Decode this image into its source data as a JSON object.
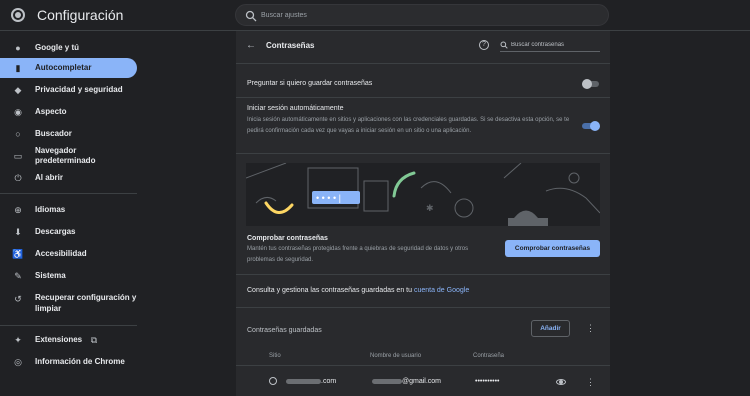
{
  "app": {
    "title": "Configuración",
    "logo_icon": "chrome-logo-icon"
  },
  "search": {
    "placeholder": "Buscar ajustes"
  },
  "sidebar": {
    "items": [
      {
        "label": "Google y tú",
        "icon": "person-icon"
      },
      {
        "label": "Autocompletar",
        "icon": "clipboard-icon",
        "active": true
      },
      {
        "label": "Privacidad y seguridad",
        "icon": "shield-icon"
      },
      {
        "label": "Aspecto",
        "icon": "palette-icon"
      },
      {
        "label": "Buscador",
        "icon": "search-icon"
      },
      {
        "label": "Navegador predeterminado",
        "icon": "browser-icon"
      },
      {
        "label": "Al abrir",
        "icon": "power-icon"
      },
      {
        "label": "Idiomas",
        "icon": "globe-icon"
      },
      {
        "label": "Descargas",
        "icon": "download-icon"
      },
      {
        "label": "Accesibilidad",
        "icon": "accessibility-icon"
      },
      {
        "label": "Sistema",
        "icon": "wrench-icon"
      },
      {
        "label": "Recuperar configuración y",
        "label2": "limpiar",
        "icon": "restore-icon"
      },
      {
        "label": "Extensiones",
        "icon": "puzzle-icon"
      },
      {
        "label": "Información de Chrome",
        "icon": "chrome-icon"
      }
    ]
  },
  "passwords": {
    "title": "Contraseñas",
    "search_placeholder": "Buscar contraseñas",
    "offer_save": {
      "label": "Preguntar si quiero guardar contraseñas",
      "enabled": false
    },
    "auto_signin": {
      "label": "Iniciar sesión automáticamente",
      "description": "Inicia sesión automáticamente en sitios y aplicaciones con las credenciales guardadas. Si se desactiva esta opción, se te pedirá confirmación cada vez que vayas a iniciar sesión en un sitio o una aplicación.",
      "enabled": true
    },
    "checkup": {
      "title": "Comprobar contraseñas",
      "description": "Mantén tus contraseñas protegidas frente a quiebras de seguridad de datos y otros problemas de seguridad.",
      "button": "Comprobar contraseñas"
    },
    "manage": {
      "text": "Consulta y gestiona las contraseñas guardadas en tu ",
      "link": "cuenta de Google"
    },
    "saved": {
      "title": "Contraseñas guardadas",
      "add_button": "Añadir",
      "columns": [
        "Sitio",
        "Nombre de usuario",
        "Contraseña"
      ],
      "rows": [
        {
          "site": ".com",
          "username": "@gmail.com",
          "password": "••••••••••"
        }
      ]
    }
  },
  "colors": {
    "accent": "#8ab4f8",
    "background": "#202124",
    "card": "#292a2d"
  }
}
